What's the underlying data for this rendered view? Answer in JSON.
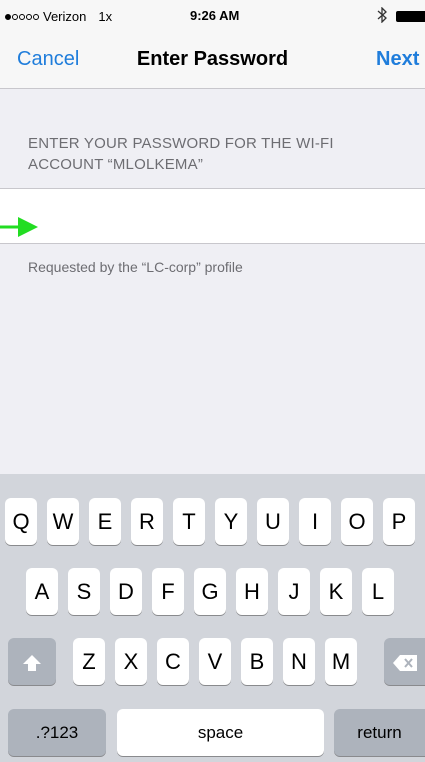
{
  "status_bar": {
    "carrier": "Verizon",
    "network": "1x",
    "time": "9:26 AM",
    "icons": [
      "signal-dots-icon",
      "bluetooth-icon",
      "battery-icon"
    ]
  },
  "nav": {
    "cancel_label": "Cancel",
    "title": "Enter Password",
    "next_label": "Next"
  },
  "section": {
    "header_line1": "ENTER YOUR PASSWORD FOR THE WI-FI",
    "header_line2": "ACCOUNT “MLOLKEMA”",
    "password_value": "",
    "footer_note": "Requested by the “LC-corp” profile"
  },
  "keyboard": {
    "row1": [
      "Q",
      "W",
      "E",
      "R",
      "T",
      "Y",
      "U",
      "I",
      "O",
      "P"
    ],
    "row2": [
      "A",
      "S",
      "D",
      "F",
      "G",
      "H",
      "J",
      "K",
      "L"
    ],
    "row3": [
      "Z",
      "X",
      "C",
      "V",
      "B",
      "N",
      "M"
    ],
    "numbers_label": ".?123",
    "space_label": "space",
    "return_label": "return",
    "shift_icon": "shift-arrow-icon",
    "delete_icon": "delete-backspace-icon"
  },
  "colors": {
    "accent": "#1f7ddb",
    "arrow": "#22dd22",
    "background": "#efeff4",
    "keyboard_bg": "#d2d5db"
  }
}
